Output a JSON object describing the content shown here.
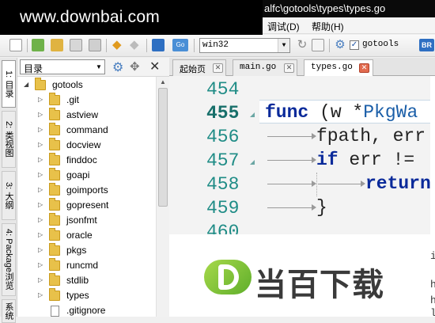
{
  "title_bar": {
    "watermark": "www.downbai.com",
    "path_text": "alfc\\gotools\\types\\types.go"
  },
  "menu_bar": {
    "items": [
      "调试(D)",
      "帮助(H)"
    ]
  },
  "toolbar": {
    "build_target": "win32",
    "checkbox_checked": true,
    "checkbox_label": "gotools",
    "trailing_label": "BR"
  },
  "side_tabs": [
    {
      "label": "1: 目录",
      "active": true
    },
    {
      "label": "2: 类视图",
      "active": false
    },
    {
      "label": "3: 大纲",
      "active": false
    },
    {
      "label": "4: Package浏览",
      "active": false
    },
    {
      "label": "系统",
      "active": false
    }
  ],
  "left_panel": {
    "view_selector": "目录",
    "tree": [
      {
        "label": "gotools",
        "type": "folder",
        "expanded": true,
        "level": 0
      },
      {
        "label": ".git",
        "type": "folder",
        "level": 1
      },
      {
        "label": "astview",
        "type": "folder",
        "level": 1
      },
      {
        "label": "command",
        "type": "folder",
        "level": 1
      },
      {
        "label": "docview",
        "type": "folder",
        "level": 1
      },
      {
        "label": "finddoc",
        "type": "folder",
        "level": 1
      },
      {
        "label": "goapi",
        "type": "folder",
        "level": 1
      },
      {
        "label": "goimports",
        "type": "folder",
        "level": 1
      },
      {
        "label": "gopresent",
        "type": "folder",
        "level": 1
      },
      {
        "label": "jsonfmt",
        "type": "folder",
        "level": 1
      },
      {
        "label": "oracle",
        "type": "folder",
        "level": 1
      },
      {
        "label": "pkgs",
        "type": "folder",
        "level": 1
      },
      {
        "label": "runcmd",
        "type": "folder",
        "level": 1
      },
      {
        "label": "stdlib",
        "type": "folder",
        "level": 1
      },
      {
        "label": "types",
        "type": "folder",
        "level": 1
      },
      {
        "label": ".gitignore",
        "type": "file",
        "level": 1
      }
    ]
  },
  "editor_tabs": [
    {
      "label": "起始页",
      "active": false
    },
    {
      "label": "main.go",
      "active": false
    },
    {
      "label": "types.go",
      "active": true
    }
  ],
  "editor": {
    "current_line": 455,
    "lines": [
      {
        "number": "454",
        "tokens": []
      },
      {
        "number": "455",
        "tokens": [
          {
            "t": "func",
            "c": "kw"
          },
          {
            "t": " (w *",
            "c": "id"
          },
          {
            "t": "PkgWa",
            "c": "ty"
          }
        ]
      },
      {
        "number": "456",
        "tokens": [
          {
            "t": "fpath, err",
            "c": "id"
          }
        ]
      },
      {
        "number": "457",
        "tokens": [
          {
            "t": "if",
            "c": "kw"
          },
          {
            "t": " err != ",
            "c": "id"
          }
        ]
      },
      {
        "number": "458",
        "tokens": [
          {
            "t": "return",
            "c": "kw"
          }
        ]
      },
      {
        "number": "459",
        "tokens": [
          {
            "t": "}",
            "c": "id"
          }
        ]
      },
      {
        "number": "460",
        "tokens": []
      }
    ]
  },
  "watermark_brand": "当百下载",
  "edge_fragments": [
    "i",
    "h",
    "h",
    "l"
  ]
}
